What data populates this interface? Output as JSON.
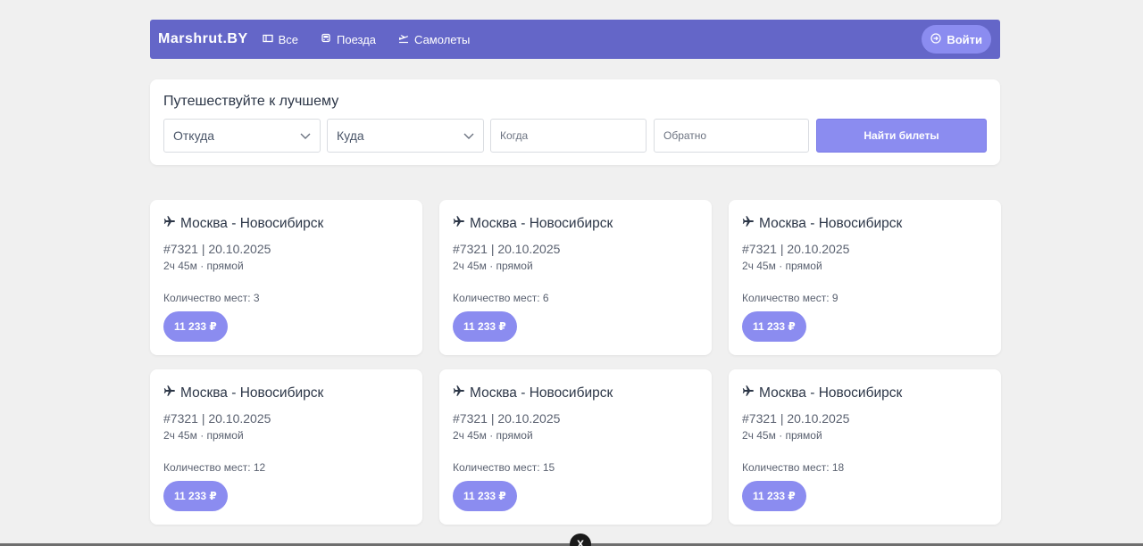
{
  "nav": {
    "brand": "Marshrut.BY",
    "links": [
      {
        "label": "Все",
        "icon": "ticket-icon"
      },
      {
        "label": "Поезда",
        "icon": "train-icon"
      },
      {
        "label": "Самолеты",
        "icon": "plane-departure-icon"
      }
    ],
    "login_label": "Войти"
  },
  "search": {
    "title": "Путешествуйте к лучшему",
    "from_label": "Откуда",
    "to_label": "Куда",
    "when_placeholder": "Когда",
    "return_placeholder": "Обратно",
    "button_label": "Найти билеты"
  },
  "colors": {
    "accent": "#6466c8",
    "accent_light": "#8b8cf0",
    "background": "#f0f0f0"
  },
  "trips": [
    {
      "route": "Москва - Новосибирск",
      "meta": "#7321 | 20.10.2025",
      "sub": "2ч 45м · прямой",
      "seats": "Количество мест: 3",
      "price": "11 233 ₽"
    },
    {
      "route": "Москва - Новосибирск",
      "meta": "#7321 | 20.10.2025",
      "sub": "2ч 45м · прямой",
      "seats": "Количество мест: 6",
      "price": "11 233 ₽"
    },
    {
      "route": "Москва - Новосибирск",
      "meta": "#7321 | 20.10.2025",
      "sub": "2ч 45м · прямой",
      "seats": "Количество мест: 9",
      "price": "11 233 ₽"
    },
    {
      "route": "Москва - Новосибирск",
      "meta": "#7321 | 20.10.2025",
      "sub": "2ч 45м · прямой",
      "seats": "Количество мест: 12",
      "price": "11 233 ₽"
    },
    {
      "route": "Москва - Новосибирск",
      "meta": "#7321 | 20.10.2025",
      "sub": "2ч 45м · прямой",
      "seats": "Количество мест: 15",
      "price": "11 233 ₽"
    },
    {
      "route": "Москва - Новосибирск",
      "meta": "#7321 | 20.10.2025",
      "sub": "2ч 45м · прямой",
      "seats": "Количество мест: 18",
      "price": "11 233 ₽"
    }
  ],
  "overlay": {
    "close_glyph": "X"
  }
}
